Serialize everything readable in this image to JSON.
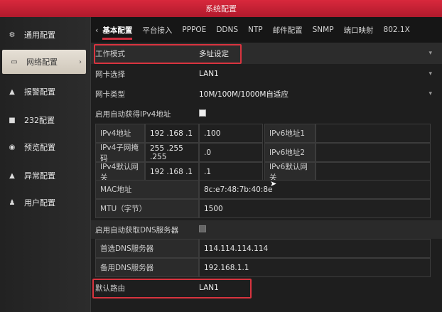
{
  "window": {
    "title": "系统配置"
  },
  "sidebar": {
    "items": [
      {
        "icon": "gear-icon",
        "glyph": "⚙",
        "label": "通用配置"
      },
      {
        "icon": "network-icon",
        "glyph": "▭",
        "label": "网络配置",
        "active": true,
        "arrow": "›"
      },
      {
        "icon": "alarm-icon",
        "glyph": "▲",
        "label": "报警配置"
      },
      {
        "icon": "serial-icon",
        "glyph": "■",
        "label": "232配置"
      },
      {
        "icon": "preview-icon",
        "glyph": "◉",
        "label": "预览配置"
      },
      {
        "icon": "exception-icon",
        "glyph": "▲",
        "label": "异常配置"
      },
      {
        "icon": "user-icon",
        "glyph": "♟",
        "label": "用户配置"
      }
    ]
  },
  "tabs": {
    "back_arrow": "‹",
    "items": [
      "基本配置",
      "平台接入",
      "PPPOE",
      "DDNS",
      "NTP",
      "邮件配置",
      "SNMP",
      "端口映射",
      "802.1X"
    ]
  },
  "form": {
    "work_mode": {
      "label": "工作模式",
      "value": "多址设定"
    },
    "nic_select": {
      "label": "网卡选择",
      "value": "LAN1"
    },
    "nic_type": {
      "label": "网卡类型",
      "value": "10M/100M/1000M自适应"
    },
    "dhcp": {
      "label": "启用自动获得IPv4地址"
    },
    "ipv4_addr": {
      "label": "IPv4地址",
      "part1": "192 .168 .1",
      "part2": ".100"
    },
    "ipv4_mask": {
      "label": "IPv4子网掩码",
      "part1": "255 .255 .255",
      "part2": ".0"
    },
    "ipv4_gw": {
      "label": "IPv4默认网关",
      "part1": "192 .168 .1",
      "part2": ".1"
    },
    "ipv6_addr1": {
      "label": "IPv6地址1"
    },
    "ipv6_addr2": {
      "label": "IPv6地址2"
    },
    "ipv6_gw": {
      "label": "IPv6默认网关"
    },
    "mac": {
      "label": "MAC地址",
      "value": "8c:e7:48:7b:40:8e"
    },
    "mtu": {
      "label": "MTU（字节）",
      "value": "1500"
    },
    "dns_auto": {
      "label": "启用自动获取DNS服务器"
    },
    "dns_pref": {
      "label": "首选DNS服务器",
      "value": "114.114.114.114"
    },
    "dns_alt": {
      "label": "备用DNS服务器",
      "value": "192.168.1.1"
    },
    "default_route": {
      "label": "默认路由",
      "value": "LAN1"
    }
  }
}
